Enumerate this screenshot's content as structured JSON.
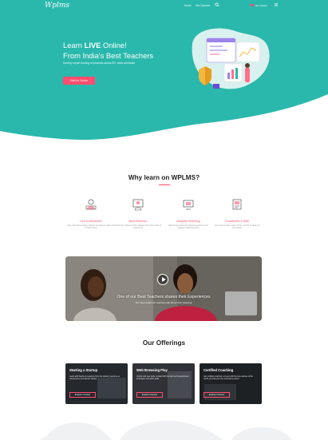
{
  "nav": {
    "logo": "Wplms",
    "links": [
      "Home",
      "Our Courses"
    ],
    "signin": "Get started"
  },
  "hero": {
    "title_pre": "Learn ",
    "title_em": "LIVE",
    "title_post": " Online!",
    "title_line2": "From India's Best Teachers",
    "subtitle": "Develop expert tutoring on students across 30+ cities worldwide",
    "button": "Start for Course"
  },
  "why": {
    "title": "Why learn on WPLMS?",
    "features": [
      {
        "title": "Live & Interactive",
        "desc": "Fully interactive online classes & teachers within the content items",
        "icon": "live-class-icon"
      },
      {
        "title": "Best Teachers",
        "desc": "Teach the online top the colleges from the cadre of experience",
        "icon": "teacher-icon"
      },
      {
        "title": "Adaptive Teaching",
        "desc": "Delivering customized learning paths to the student's learning pace",
        "icon": "adaptive-icon"
      },
      {
        "title": "Convenient & Safe",
        "desc": "Get used to learn, learn at the comfort & safety of your home",
        "icon": "safe-icon"
      }
    ]
  },
  "banner": {
    "title": "One of our Best Teachers shares their Experiences",
    "subtitle": "We have heard our teachers talk about their teaching"
  },
  "offerings": {
    "title": "Our Offerings",
    "cards": [
      {
        "title": "Starting a Startup",
        "desc": "Learn with hands-on sessions from the industry, become an entrepreneur and launch startup",
        "button": "Explore Courses"
      },
      {
        "title": "Web Browsing Play",
        "desc": "Unlock with new tools, contact with the best web development techniques and other skills",
        "button": "Explore Courses"
      },
      {
        "title": "Certified Coaching",
        "desc": "Get certified coaching, connect with the top coaches of the world, do what you love and build a career",
        "button": "Explore Courses"
      }
    ]
  },
  "colors": {
    "teal": "#2ab8ac",
    "accent": "#ff4d6d"
  }
}
